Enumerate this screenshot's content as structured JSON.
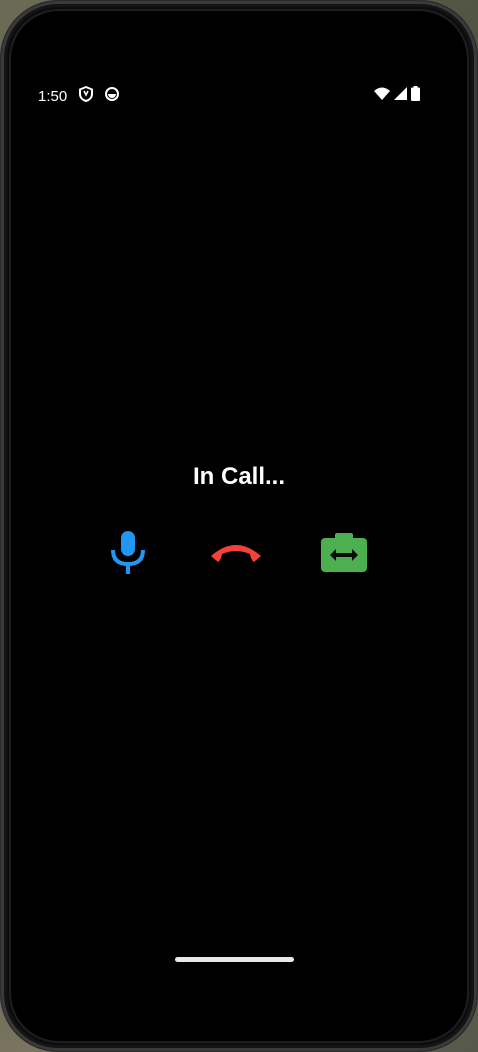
{
  "status_bar": {
    "time": "1:50",
    "left_icons": [
      "shield-icon",
      "notification-badge-icon"
    ],
    "right_icons": [
      "wifi-icon",
      "cell-signal-icon",
      "battery-icon"
    ]
  },
  "call": {
    "title": "In Call..."
  },
  "controls": {
    "mic_icon": "microphone-icon",
    "hangup_icon": "end-call-icon",
    "switch_camera_icon": "switch-camera-icon"
  },
  "colors": {
    "background": "#000000",
    "mic": "#2196F3",
    "hangup": "#F44336",
    "switch_camera": "#4CAF50",
    "text": "#FFFFFF"
  }
}
